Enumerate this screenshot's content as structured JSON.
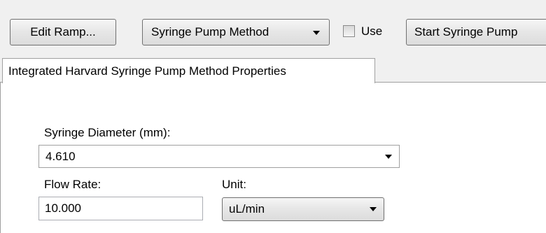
{
  "toolbar": {
    "edit_ramp_label": "Edit Ramp...",
    "method_dropdown_value": "Syringe Pump Method",
    "use_checkbox_label": "Use",
    "use_checked": false,
    "start_button_label": "Start Syringe Pump"
  },
  "tab": {
    "label": "Integrated Harvard Syringe Pump Method Properties"
  },
  "form": {
    "diameter_label": "Syringe Diameter (mm):",
    "diameter_value": "4.610",
    "flow_rate_label": "Flow Rate:",
    "flow_rate_value": "10.000",
    "unit_label": "Unit:",
    "unit_value": "uL/min"
  },
  "icons": {
    "dropdown": "chevron-down-icon",
    "checkbox": "checkbox-icon"
  }
}
